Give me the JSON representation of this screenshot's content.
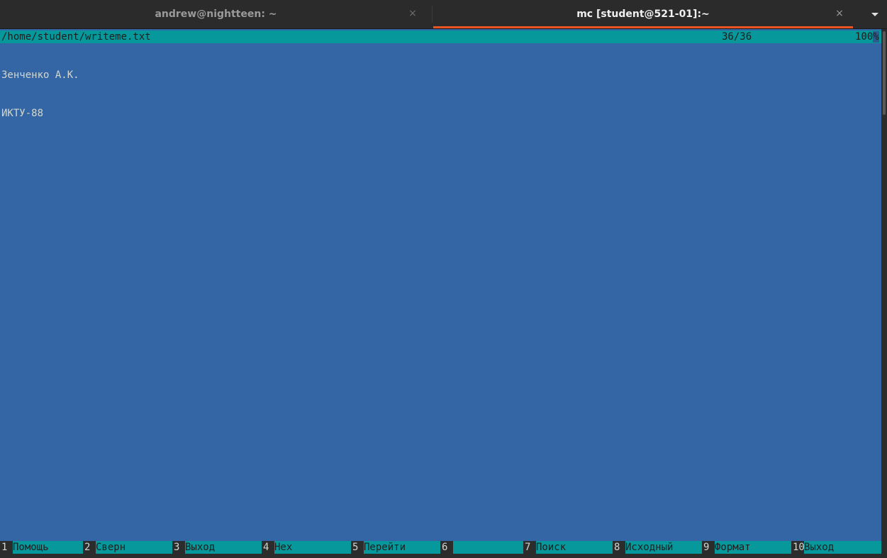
{
  "tabs": [
    {
      "title": "andrew@nightteen: ~",
      "close": "×",
      "active": false
    },
    {
      "title": "mc [student@521-01]:~",
      "close": "×",
      "active": true
    }
  ],
  "tab_menu_icon": "chevron-down-icon",
  "accent_color": "#e95420",
  "viewer": {
    "path": "/home/student/writeme.txt",
    "position": "36/36",
    "percent_main": "100",
    "percent_last": "%",
    "lines": [
      "Зенченко А.К.",
      "ИКТУ-88"
    ]
  },
  "fkeys": [
    {
      "num": "1",
      "label": "Помощь"
    },
    {
      "num": "2",
      "label": "Сверн"
    },
    {
      "num": "3",
      "label": "Выход"
    },
    {
      "num": "4",
      "label": "Hex"
    },
    {
      "num": "5",
      "label": "Перейти"
    },
    {
      "num": "6",
      "label": ""
    },
    {
      "num": "7",
      "label": "Поиск"
    },
    {
      "num": "8",
      "label": "Исходный"
    },
    {
      "num": "9",
      "label": "Формат"
    },
    {
      "num": "10",
      "label": "Выход"
    }
  ],
  "colors": {
    "background": "#3465a4",
    "bar": "#06989a",
    "text": "#d3d7cf"
  }
}
